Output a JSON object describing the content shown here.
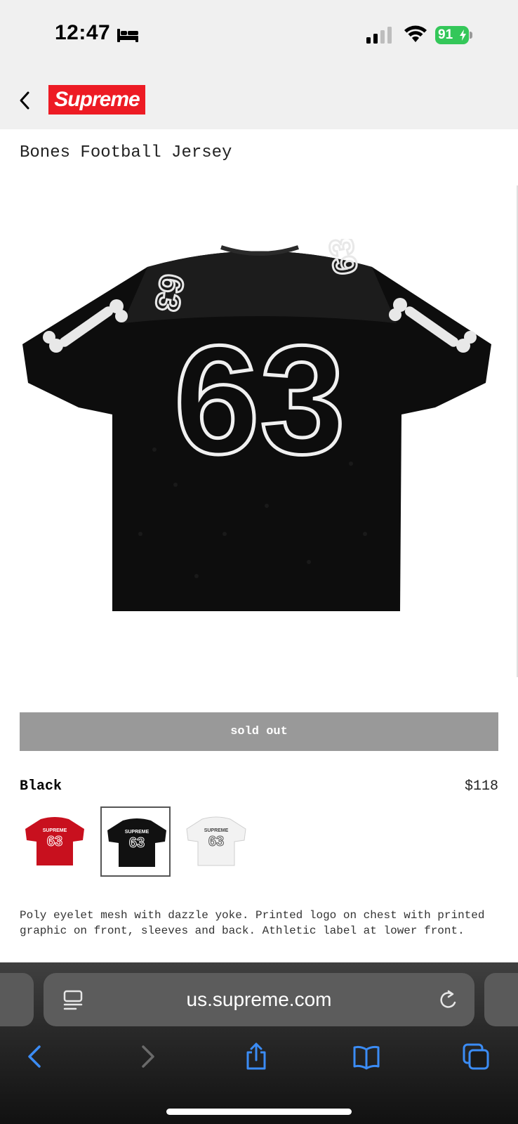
{
  "status_bar": {
    "time": "12:47",
    "battery": "91",
    "icons": [
      "bed-icon",
      "signal-icon",
      "wifi-icon",
      "battery-charging-icon"
    ]
  },
  "header": {
    "back_icon": "chevron-left-icon",
    "logo_text": "Supreme",
    "logo_color": "#ed1b24"
  },
  "product": {
    "title": "Bones Football Jersey",
    "image_number": "63",
    "sold_out_label": "sold out",
    "color_name": "Black",
    "price": "$118",
    "swatches": [
      {
        "color": "#c8101e",
        "number": "63",
        "brand": "SUPREME",
        "selected": false
      },
      {
        "color": "#111111",
        "number": "63",
        "brand": "SUPREME",
        "selected": true
      },
      {
        "color": "#f2f2f2",
        "number": "63",
        "brand": "SUPREME",
        "selected": false
      }
    ],
    "description": "Poly eyelet mesh with dazzle yoke. Printed logo on chest with printed graphic on front, sleeves and back. Athletic label at lower front."
  },
  "browser": {
    "url": "us.supreme.com",
    "toolbar_icons": [
      "back-icon",
      "forward-icon",
      "share-icon",
      "bookmarks-icon",
      "tabs-icon"
    ]
  }
}
